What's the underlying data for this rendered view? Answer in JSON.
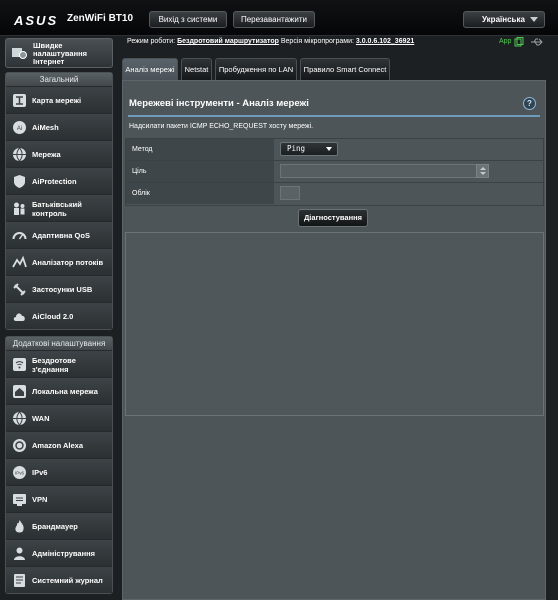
{
  "header": {
    "logo": "ASUS",
    "model": "ZenWiFi BT10",
    "logout_label": "Вихід з системи",
    "reboot_label": "Перезавантажити",
    "language": "Українська"
  },
  "status": {
    "mode_label": "Режим роботи:",
    "mode_value": "Бездротовий маршрутизатор",
    "firmware_label": "Версія мікропрограми:",
    "firmware_value": "3.0.0.6.102_36921",
    "app_label": "App"
  },
  "sidebar": {
    "quick_label": "Швидке налаштування Інтернет",
    "general_header": "Загальний",
    "general_items": [
      {
        "label": "Карта мережі",
        "icon": "network-map-icon"
      },
      {
        "label": "AiMesh",
        "icon": "aimesh-icon"
      },
      {
        "label": "Мережа",
        "icon": "globe-icon"
      },
      {
        "label": "AiProtection",
        "icon": "shield-icon"
      },
      {
        "label": "Батьківський контроль",
        "icon": "family-icon"
      },
      {
        "label": "Адаптивна QoS",
        "icon": "speedometer-icon"
      },
      {
        "label": "Аналізатор потоків",
        "icon": "traffic-icon"
      },
      {
        "label": "Застосунки USB",
        "icon": "usb-icon"
      },
      {
        "label": "AiCloud 2.0",
        "icon": "cloud-icon"
      }
    ],
    "advanced_header": "Додаткові налаштування",
    "advanced_items": [
      {
        "label": "Бездротове з'єднання",
        "icon": "wifi-icon"
      },
      {
        "label": "Локальна мережа",
        "icon": "house-icon"
      },
      {
        "label": "WAN",
        "icon": "globe-icon"
      },
      {
        "label": "Amazon Alexa",
        "icon": "alexa-icon"
      },
      {
        "label": "IPv6",
        "icon": "ipv6-icon"
      },
      {
        "label": "VPN",
        "icon": "vpn-icon"
      },
      {
        "label": "Брандмауер",
        "icon": "fire-icon"
      },
      {
        "label": "Адміністрування",
        "icon": "admin-icon"
      },
      {
        "label": "Системний журнал",
        "icon": "log-icon"
      }
    ]
  },
  "tabs": [
    {
      "label": "Аналіз мережі",
      "active": true
    },
    {
      "label": "Netstat",
      "active": false
    },
    {
      "label": "Пробудження по LAN",
      "active": false
    },
    {
      "label": "Правило Smart Connect",
      "active": false
    }
  ],
  "main": {
    "title": "Мережеві інструменти - Аналіз мережі",
    "description": "Надсилати пакети ICMP ECHO_REQUEST хосту мережі.",
    "method_label": "Метод",
    "method_value": "Ping",
    "target_label": "Ціль",
    "target_placeholder": "",
    "count_label": "Облік",
    "diagnose_label": "Діагностування"
  },
  "colors": {
    "background": "#1c2022",
    "panel": "#4d5559",
    "accent_line": "#6e9cba",
    "app_green": "#4ec94e"
  }
}
